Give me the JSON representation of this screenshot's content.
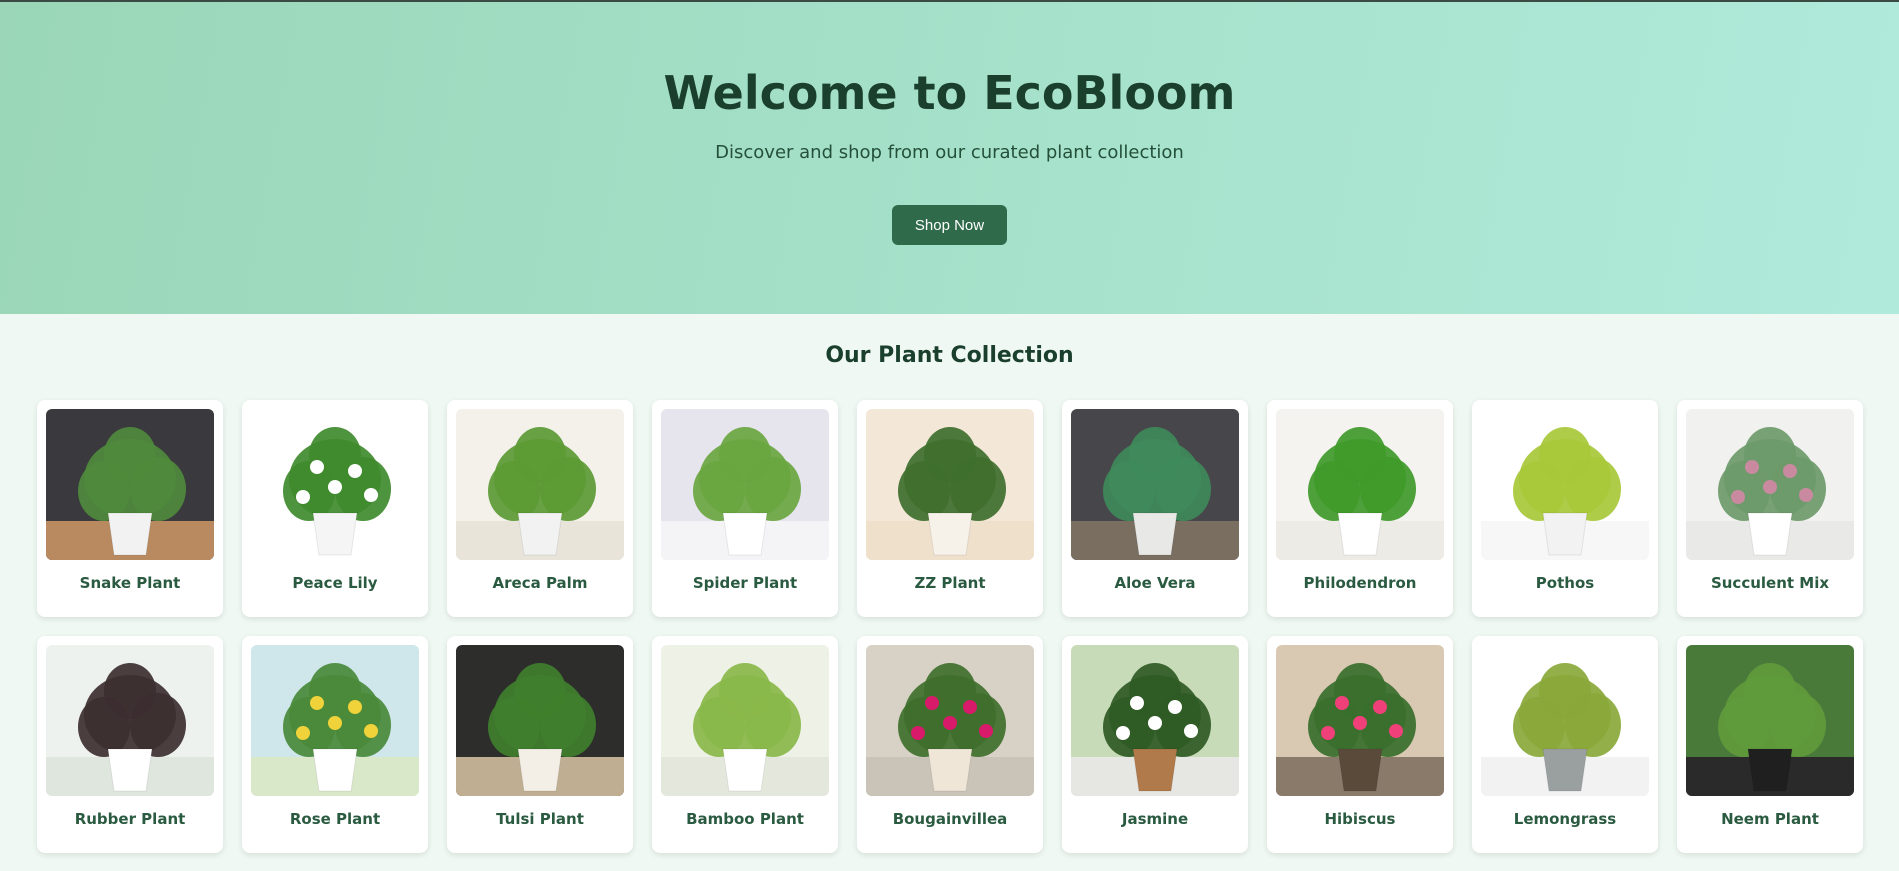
{
  "hero": {
    "title": "Welcome to EcoBloom",
    "subtitle": "Discover and shop from our curated plant collection",
    "button_label": "Shop Now"
  },
  "collection": {
    "title": "Our Plant Collection",
    "plants": [
      {
        "name": "Snake Plant",
        "bg": "#3a3a3e",
        "floor": "#b98a5f",
        "leaf": "#4f8a3c",
        "pot": "#f2f2f2",
        "flower": ""
      },
      {
        "name": "Peace Lily",
        "bg": "#ffffff",
        "floor": "#ffffff",
        "leaf": "#3f8a2c",
        "pot": "#f5f5f5",
        "flower": "#ffffff"
      },
      {
        "name": "Areca Palm",
        "bg": "#f3f1ea",
        "floor": "#e8e4da",
        "leaf": "#5c9a34",
        "pot": "#f2f2f2",
        "flower": ""
      },
      {
        "name": "Spider Plant",
        "bg": "#e6e4ec",
        "floor": "#f4f4f6",
        "leaf": "#6aa640",
        "pot": "#ffffff",
        "flower": ""
      },
      {
        "name": "ZZ Plant",
        "bg": "#f3e7d8",
        "floor": "#efe0cc",
        "leaf": "#3f6f2e",
        "pot": "#f6f2ea",
        "flower": ""
      },
      {
        "name": "Aloe Vera",
        "bg": "#47464a",
        "floor": "#7a6e60",
        "leaf": "#3f8a5a",
        "pot": "#e8e8e6",
        "flower": ""
      },
      {
        "name": "Philodendron",
        "bg": "#f4f3ef",
        "floor": "#ecebe6",
        "leaf": "#3f9a2a",
        "pot": "#ffffff",
        "flower": ""
      },
      {
        "name": "Pothos",
        "bg": "#ffffff",
        "floor": "#f7f7f7",
        "leaf": "#a8c83a",
        "pot": "#f2f2f2",
        "flower": ""
      },
      {
        "name": "Succulent Mix",
        "bg": "#f1f1ef",
        "floor": "#e9e9e7",
        "leaf": "#6e9a6a",
        "pot": "#ffffff",
        "flower": "#c98aa0"
      },
      {
        "name": "Rubber Plant",
        "bg": "#eef2ee",
        "floor": "#dfe6dd",
        "leaf": "#3c2f30",
        "pot": "#ffffff",
        "flower": ""
      },
      {
        "name": "Rose Plant",
        "bg": "#cfe6ea",
        "floor": "#d9e8c8",
        "leaf": "#4a8a3a",
        "pot": "#ffffff",
        "flower": "#f0d23a"
      },
      {
        "name": "Tulsi Plant",
        "bg": "#2d2d2b",
        "floor": "#bfae92",
        "leaf": "#3f7f2c",
        "pot": "#f3efe6",
        "flower": ""
      },
      {
        "name": "Bamboo Plant",
        "bg": "#eef1e6",
        "floor": "#e4e8dc",
        "leaf": "#8ab84a",
        "pot": "#ffffff",
        "flower": ""
      },
      {
        "name": "Bougainvillea",
        "bg": "#d8d2c6",
        "floor": "#c9c3b8",
        "leaf": "#3f6f2c",
        "pot": "#efe6d8",
        "flower": "#d81a6a"
      },
      {
        "name": "Jasmine",
        "bg": "#c8dbb8",
        "floor": "#e6e6e2",
        "leaf": "#2f5a24",
        "pot": "#b07a4a",
        "flower": "#ffffff"
      },
      {
        "name": "Hibiscus",
        "bg": "#d9c9b3",
        "floor": "#8a7a6a",
        "leaf": "#3a6f2c",
        "pot": "#5a4a3a",
        "flower": "#f0407a"
      },
      {
        "name": "Lemongrass",
        "bg": "#ffffff",
        "floor": "#f2f2f2",
        "leaf": "#8aa83a",
        "pot": "#9aa0a0",
        "flower": ""
      },
      {
        "name": "Neem Plant",
        "bg": "#4a7a3a",
        "floor": "#2a2a2a",
        "leaf": "#5f9a3c",
        "pot": "#1f1f1f",
        "flower": ""
      }
    ]
  }
}
